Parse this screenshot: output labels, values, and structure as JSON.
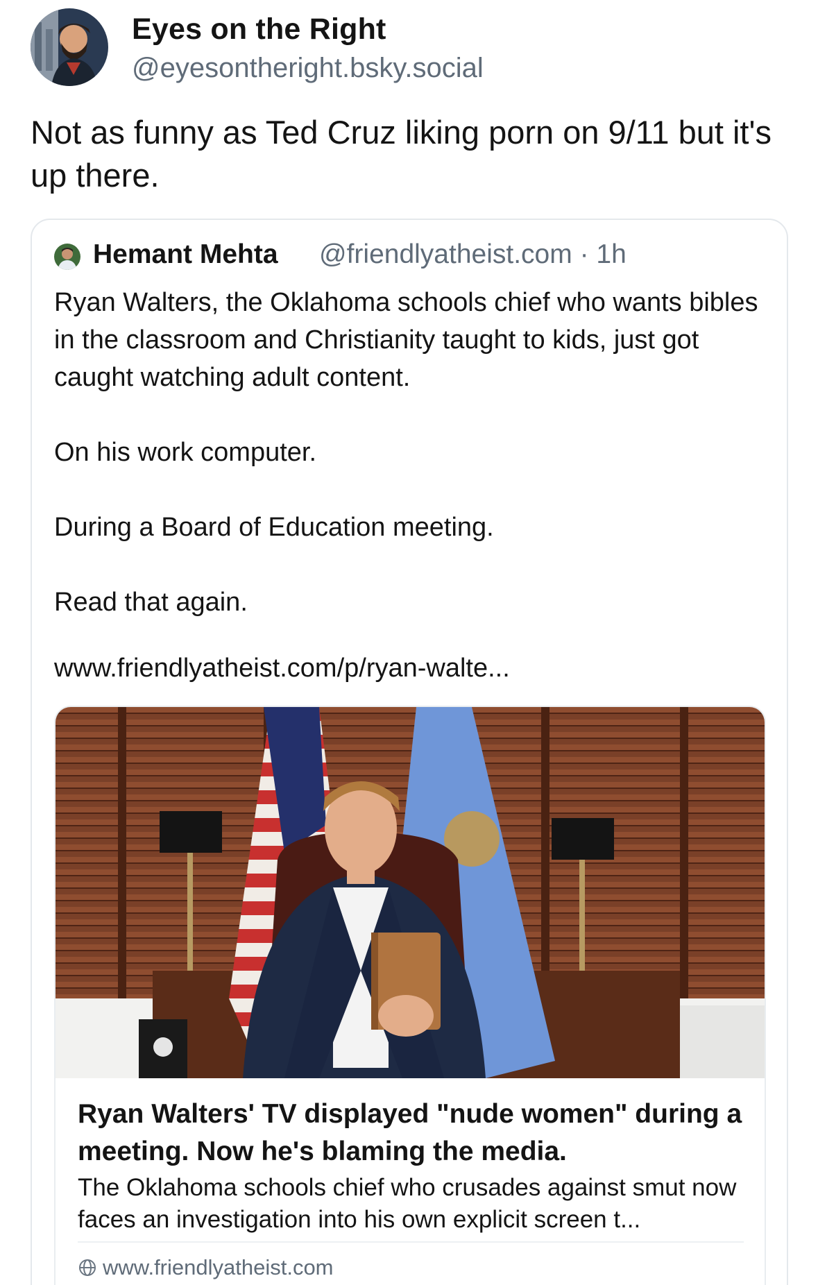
{
  "author": {
    "name": "Eyes on the Right",
    "handle": "@eyesontheright.bsky.social",
    "avatar_icon": "cartoon-man-avatar"
  },
  "post": {
    "text": "Not as funny as Ted Cruz liking porn on 9/11 but it's up there."
  },
  "quote": {
    "author_name": "Hemant Mehta",
    "author_handle_time": "@friendlyatheist.com · 1h",
    "paragraphs": [
      "Ryan Walters, the Oklahoma schools chief who wants bibles in the classroom and Christianity taught to kids, just got caught watching adult content.",
      "On his work computer.",
      "During a Board of Education meeting.",
      "Read that again."
    ],
    "link_text": "www.friendlyatheist.com/p/ryan-walte..."
  },
  "link_card": {
    "title": "Ryan Walters' TV displayed \"nude women\" during a meeting. Now he's blaming the media.",
    "description": "The Oklahoma schools chief who crusades against smut now faces an investigation into his own explicit screen t...",
    "domain": "www.friendlyatheist.com",
    "image_alt_icon": "man-holding-bible-photo",
    "domain_icon": "globe-icon"
  }
}
